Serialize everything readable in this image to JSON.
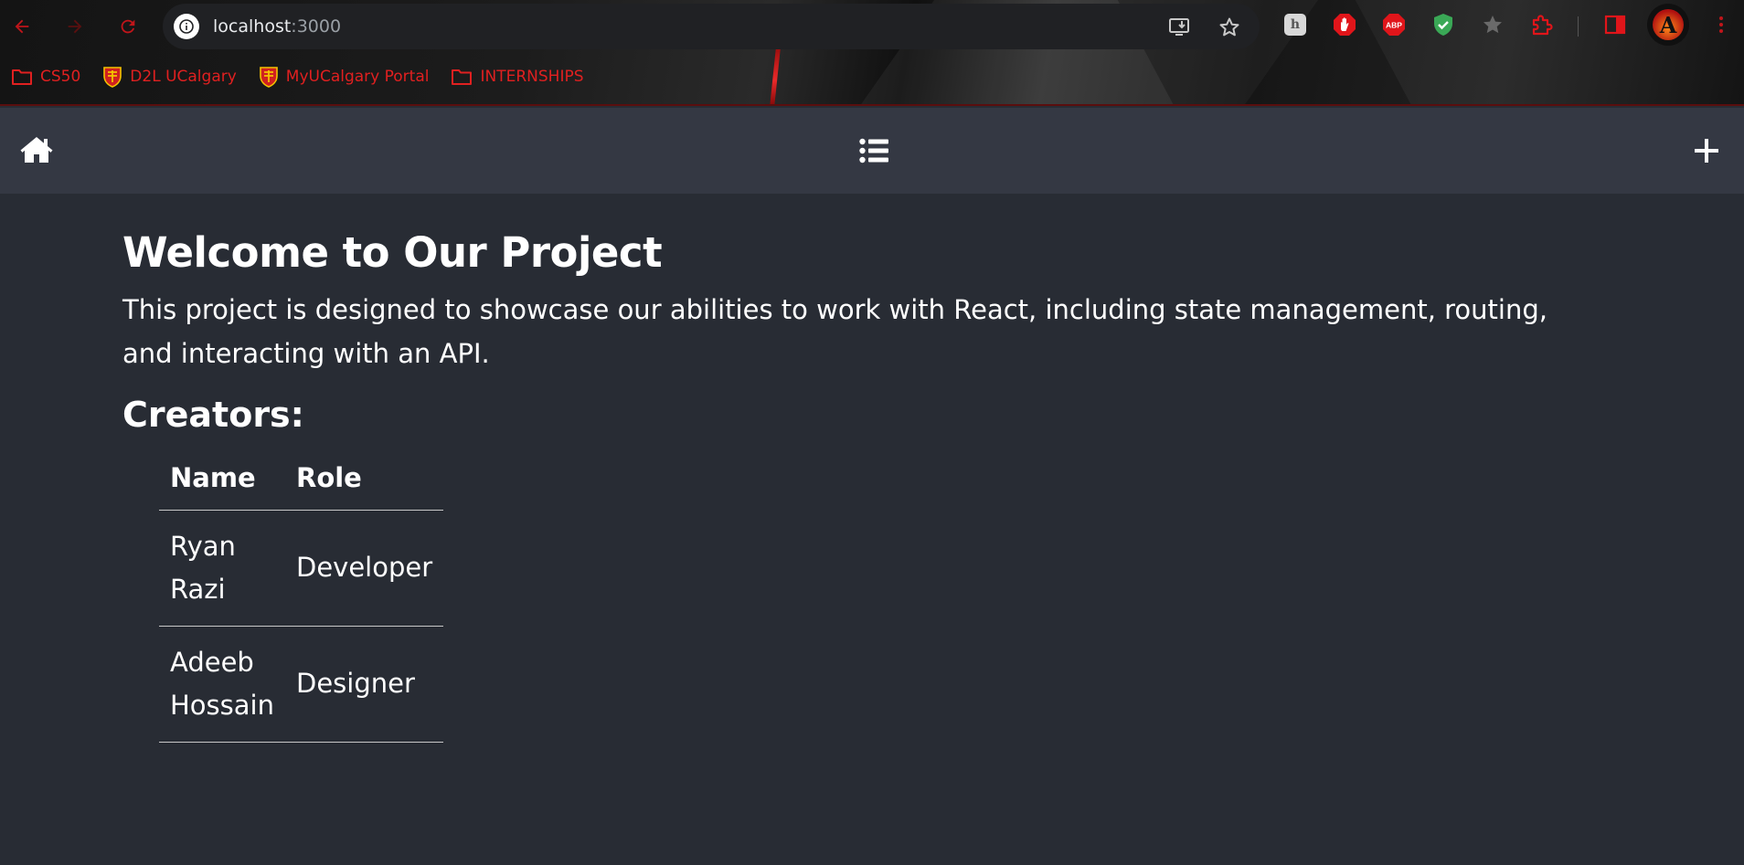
{
  "browser": {
    "url_host": "localhost",
    "url_port": ":3000",
    "bookmarks": [
      {
        "label": "CS50",
        "icon": "folder-icon"
      },
      {
        "label": "D2L UCalgary",
        "icon": "ucalgary-crest-icon"
      },
      {
        "label": "MyUCalgary Portal",
        "icon": "ucalgary-crest-icon"
      },
      {
        "label": "INTERNSHIPS",
        "icon": "folder-icon"
      }
    ],
    "profile_initial": "A"
  },
  "navbar": {
    "home_icon": "home-icon",
    "list_icon": "list-icon",
    "add_icon": "plus-icon"
  },
  "main": {
    "title": "Welcome to Our Project",
    "description": "This project is designed to showcase our abilities to work with React, including state management, routing, and interacting with an API.",
    "creators_heading": "Creators:",
    "table": {
      "headers": [
        "Name",
        "Role"
      ],
      "rows": [
        {
          "name": "Ryan Razi",
          "role": "Developer"
        },
        {
          "name": "Adeeb Hossain",
          "role": "Designer"
        }
      ]
    }
  },
  "colors": {
    "page_bg": "#282c34",
    "navbar_bg": "#343843",
    "bookmark_text": "#e02020",
    "text": "#ffffff"
  }
}
